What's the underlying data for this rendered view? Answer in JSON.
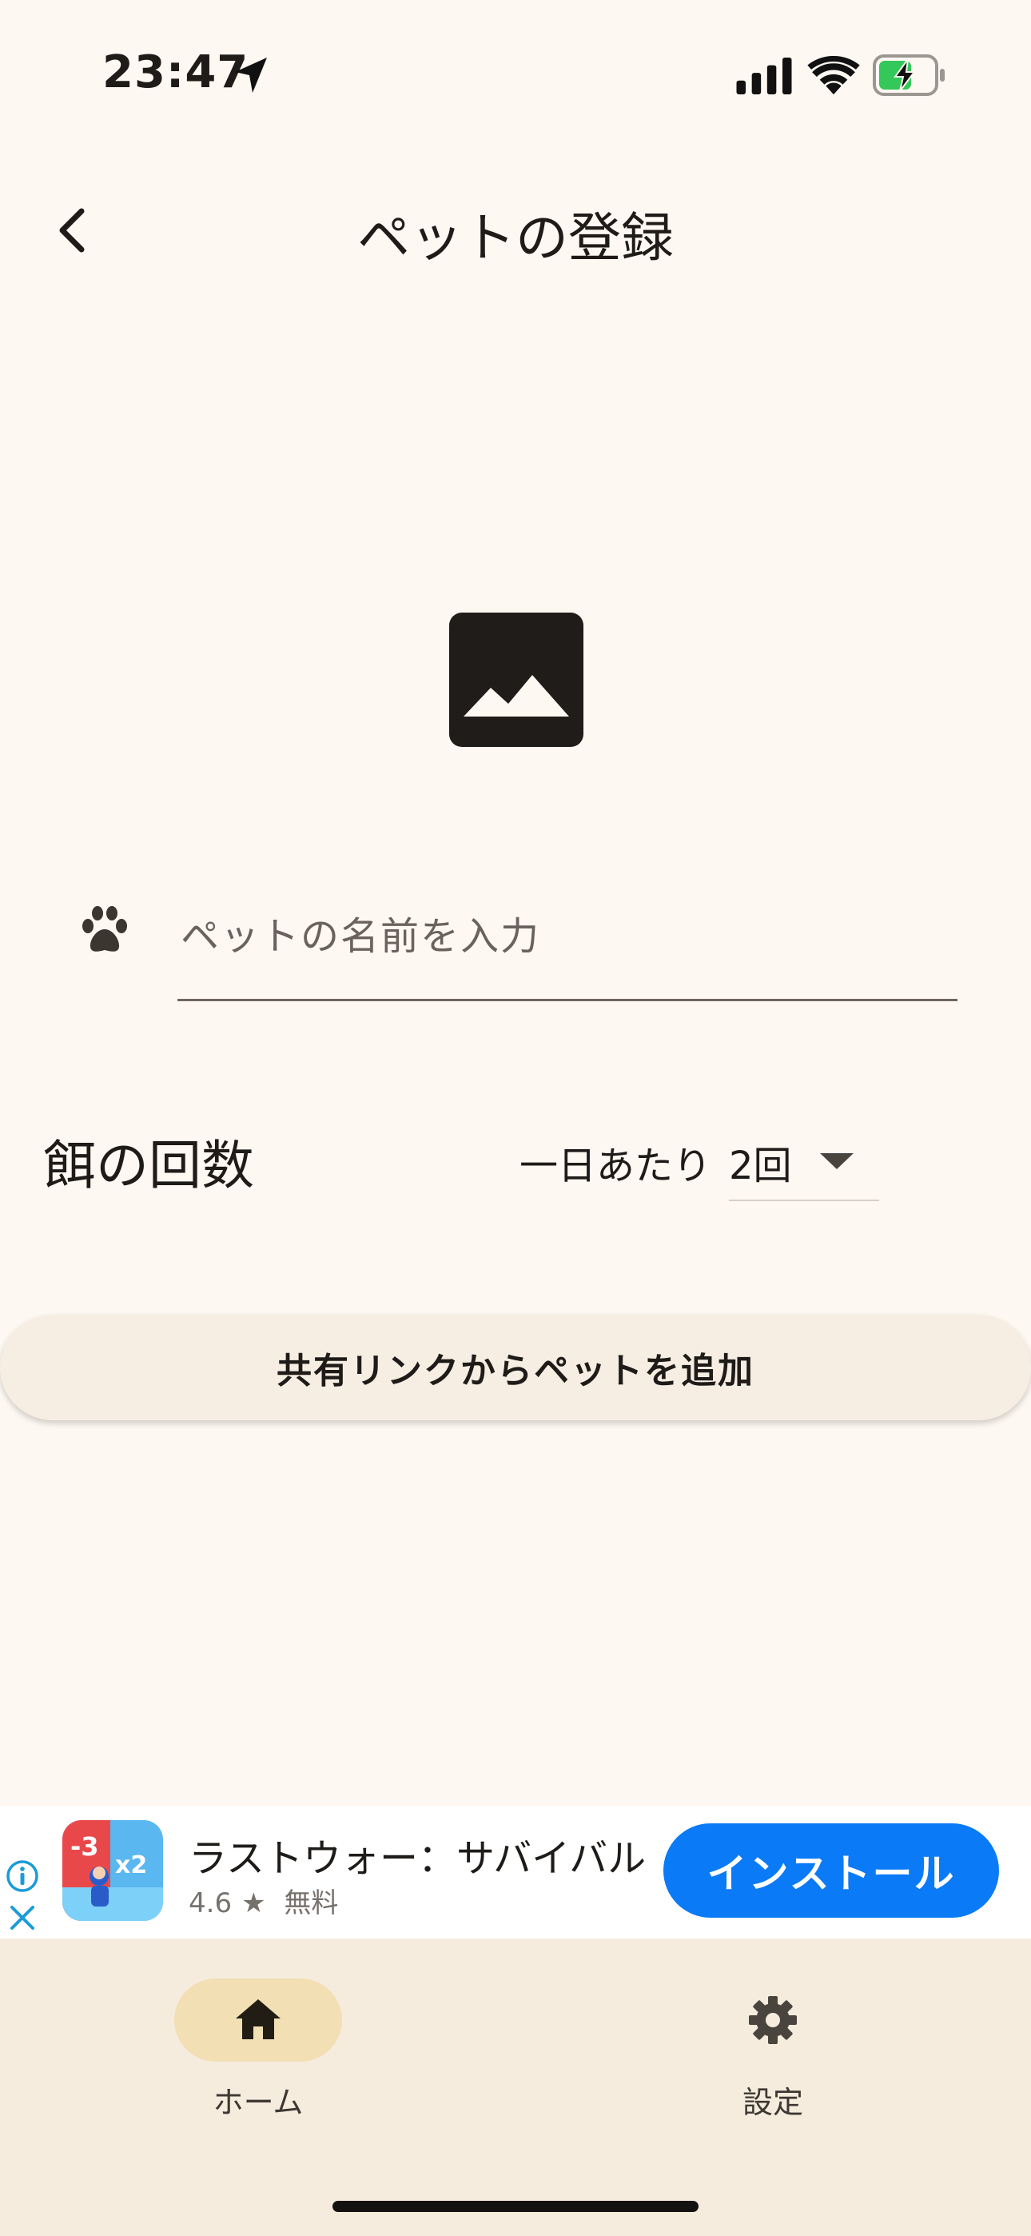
{
  "status_bar": {
    "time": "23:47",
    "icons": [
      "location-arrow-icon",
      "signal-icon",
      "wifi-icon",
      "battery-charging-icon"
    ]
  },
  "header": {
    "title": "ペットの登録",
    "back_icon": "chevron-left-icon"
  },
  "photo": {
    "icon": "image-placeholder-icon"
  },
  "pet_name": {
    "icon": "paw-icon",
    "placeholder": "ペットの名前を入力",
    "value": ""
  },
  "feeding": {
    "label": "餌の回数",
    "prefix": "一日あたり",
    "value": "2回",
    "icon": "caret-down-icon"
  },
  "share_button": {
    "label": "共有リンクからペットを追加"
  },
  "ad": {
    "app_name": "ラストウォー：サバイバル",
    "rating": "4.6",
    "rating_icon": "star-icon",
    "price": "無料",
    "install_label": "インストール",
    "info_icon": "info-icon",
    "close_icon": "close-icon"
  },
  "bottom_nav": {
    "items": [
      {
        "label": "ホーム",
        "icon": "home-icon",
        "active": true
      },
      {
        "label": "設定",
        "icon": "gear-icon",
        "active": false
      }
    ]
  },
  "colors": {
    "background": "#FEF8F2",
    "nav_background": "#F6ECDE",
    "active_pill": "#F2DFB4",
    "install_button": "#0A7AF6",
    "battery_fill": "#34C759"
  }
}
